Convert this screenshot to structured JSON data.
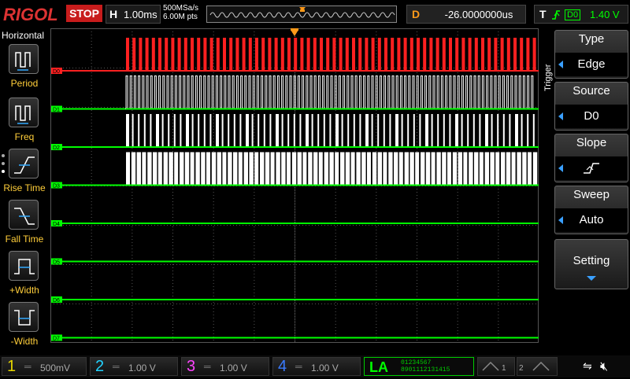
{
  "header": {
    "logo": "RIGOL",
    "run_status": "STOP",
    "timebase_letter": "H",
    "timebase": "1.00ms",
    "sample_rate": "500MSa/s",
    "memory_depth": "6.00M pts",
    "delay_letter": "D",
    "delay": "-26.0000000us",
    "trigger_letter": "T",
    "trigger_source": "D0",
    "trigger_level": "1.40 V"
  },
  "left_menu": {
    "title": "Horizontal",
    "items": [
      {
        "label": "Period",
        "icon": "period-icon"
      },
      {
        "label": "Freq",
        "icon": "freq-icon"
      },
      {
        "label": "Rise Time",
        "icon": "rise-time-icon"
      },
      {
        "label": "Fall Time",
        "icon": "fall-time-icon"
      },
      {
        "label": "+Width",
        "icon": "pos-width-icon"
      },
      {
        "label": "-Width",
        "icon": "neg-width-icon"
      }
    ]
  },
  "right_menu": {
    "title": "Trigger",
    "items": [
      {
        "title": "Type",
        "value": "Edge"
      },
      {
        "title": "Source",
        "value": "D0"
      },
      {
        "title": "Slope",
        "value": "",
        "icon": "rising-edge-icon"
      },
      {
        "title": "Sweep",
        "value": "Auto"
      },
      {
        "title": "Setting",
        "value": ""
      }
    ]
  },
  "channels": {
    "labels": [
      "D0",
      "D1",
      "D2",
      "D3",
      "D4",
      "D5",
      "D6",
      "D7"
    ]
  },
  "bottom": {
    "ch1": {
      "num": "1",
      "value": "500mV",
      "color": "#e6d600"
    },
    "ch2": {
      "num": "2",
      "value": "1.00 V",
      "color": "#22d3ff"
    },
    "ch3": {
      "num": "3",
      "value": "1.00 V",
      "color": "#ff44ff"
    },
    "ch4": {
      "num": "4",
      "value": "1.00 V",
      "color": "#3a7bff"
    },
    "la_label": "LA",
    "la_row1": "01234567",
    "la_row2": "8901112131415",
    "gen1": "1",
    "gen2": "2"
  },
  "colors": {
    "d0": "#ff2020",
    "digital": "#00ff00",
    "accent": "#ff9a1a"
  }
}
